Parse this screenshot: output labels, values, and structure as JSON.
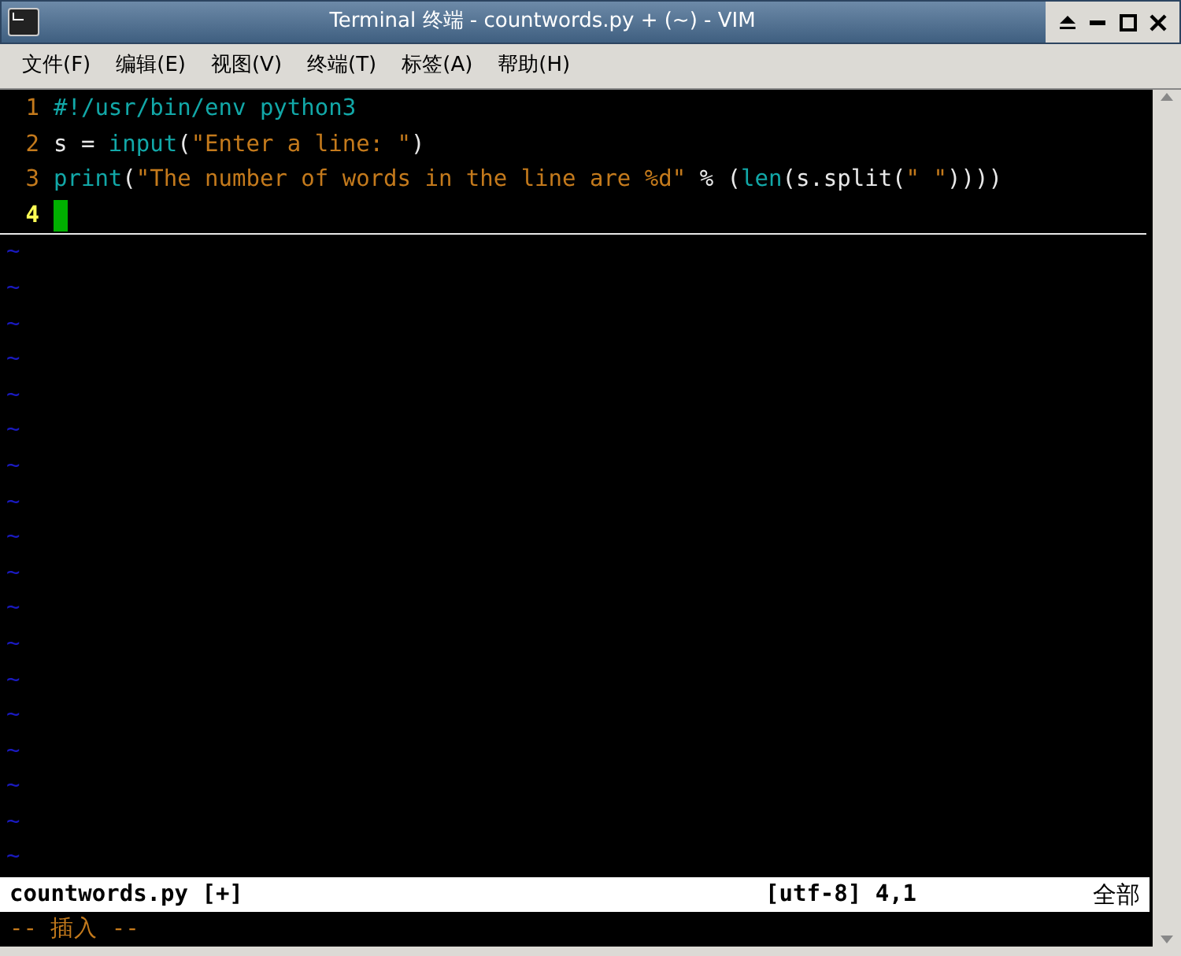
{
  "window": {
    "title": "Terminal 终端 - countwords.py + (~) - VIM"
  },
  "menu": [
    "文件(F)",
    "编辑(E)",
    "视图(V)",
    "终端(T)",
    "标签(A)",
    "帮助(H)"
  ],
  "editor": {
    "lines": [
      {
        "number": "1",
        "current": false,
        "tokens": [
          {
            "kind": "keyword",
            "text": "#!/usr/bin/env python3"
          }
        ]
      },
      {
        "number": "2",
        "current": false,
        "tokens": [
          {
            "kind": "plain",
            "text": "s = "
          },
          {
            "kind": "keyword",
            "text": "input"
          },
          {
            "kind": "plain",
            "text": "("
          },
          {
            "kind": "string",
            "text": "\"Enter a line: \""
          },
          {
            "kind": "plain",
            "text": ")"
          }
        ]
      },
      {
        "number": "3",
        "current": false,
        "tokens": [
          {
            "kind": "keyword",
            "text": "print"
          },
          {
            "kind": "plain",
            "text": "("
          },
          {
            "kind": "string",
            "text": "\"The number of words in the line are %d\""
          },
          {
            "kind": "plain",
            "text": " % ("
          },
          {
            "kind": "keyword",
            "text": "len"
          },
          {
            "kind": "plain",
            "text": "(s.split("
          },
          {
            "kind": "string",
            "text": "\" \""
          },
          {
            "kind": "plain",
            "text": "))))"
          }
        ]
      },
      {
        "number": "4",
        "current": true
      }
    ],
    "empty_markers": [
      "~",
      "~",
      "~",
      "~",
      "~",
      "~",
      "~",
      "~",
      "~",
      "~",
      "~",
      "~",
      "~",
      "~",
      "~",
      "~",
      "~",
      "~"
    ]
  },
  "status_line": {
    "file": "countwords.py [+]",
    "position": "[utf-8] 4,1",
    "scroll": "全部"
  },
  "mode_line": "-- 插入 --"
}
